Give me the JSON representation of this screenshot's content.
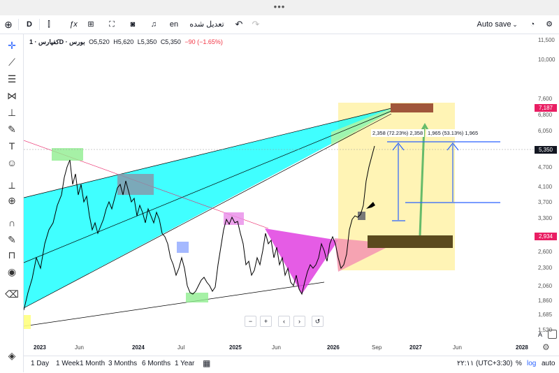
{
  "window": {
    "menu_dots": "•••"
  },
  "toolbar": {
    "symbol_label": "D",
    "fx_label": "ƒx",
    "lang_label": "en",
    "unsaved_label": "تعدیل شده",
    "autosave_label": "Auto save"
  },
  "legend": {
    "title": "کفپارس · 1D · بورس",
    "open": "O5,520",
    "high": "H5,620",
    "low": "L5,350",
    "close": "C5,350",
    "change": "−90 (−1.65%)"
  },
  "price_axis": {
    "labels": [
      "11,500",
      "10,000",
      "7,600",
      "6,800",
      "6,050",
      "4,700",
      "4,100",
      "3,700",
      "3,300",
      "2,600",
      "2,300",
      "2,060",
      "1,860",
      "1,685",
      "1,520"
    ],
    "tags": [
      {
        "text": "7,187",
        "color": "#e91e63"
      },
      {
        "text": "5,350",
        "color": "#131722"
      },
      {
        "text": "2,934",
        "color": "#e91e63"
      }
    ]
  },
  "time_axis": {
    "labels": [
      "2023",
      "Jun",
      "2024",
      "Jul",
      "2025",
      "Jun",
      "2026",
      "Sep",
      "2027",
      "Jun",
      "2028"
    ],
    "bold": [
      true,
      false,
      true,
      false,
      true,
      false,
      true,
      false,
      true,
      false,
      true
    ]
  },
  "measurements": {
    "left": "2,358 (72.23%) 2,358",
    "right": "1,965 (53.13%) 1,965"
  },
  "nav": {
    "zoom_out": "−",
    "zoom_in": "+",
    "back": "‹",
    "forward": "›",
    "reset": "↺"
  },
  "bottom": {
    "ranges": [
      "1 Day",
      "1 Week",
      "1 Month",
      "3 Months",
      "6 Months",
      "1 Year"
    ],
    "clock": "۲۲:۱۱ (UTC+3:30)",
    "percent": "%",
    "log": "log",
    "auto": "auto"
  },
  "axis_corner": {
    "a_label": "A"
  },
  "icons": [
    "add-icon",
    "undo-icon",
    "redo-icon",
    "camera-icon",
    "alert-bell-icon",
    "layout-icon",
    "fullscreen-icon",
    "settings-icon",
    "crosshair-icon",
    "trendline-icon",
    "fib-icon",
    "pattern-icon",
    "measure-icon",
    "brush-icon",
    "text-icon",
    "emoji-icon",
    "ruler-icon",
    "zoom-icon",
    "magnet-icon",
    "lock-icon",
    "eye-icon",
    "trash-icon",
    "layers-icon",
    "calendar-icon"
  ],
  "colors": {
    "accent": "#2962ff",
    "cyan": "#00ffff",
    "magenta": "#e040e0",
    "yellow": "#fff3b0",
    "brown": "#5b4a1e",
    "pink_tag": "#e91e63"
  }
}
